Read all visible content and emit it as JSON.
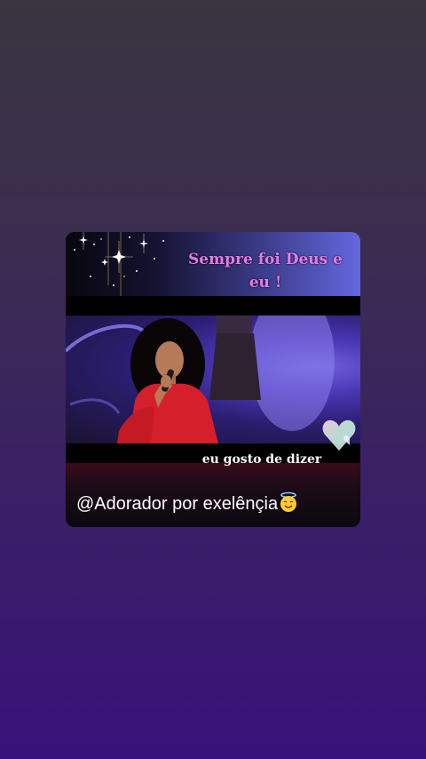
{
  "post": {
    "caption_top": "Sempre foi Deus e eu !",
    "caption_mid": "eu gosto de dizer",
    "handle": "@Adorador por exelênçia"
  },
  "icons": {
    "sparkles": "sparkles-icon",
    "heart": "heart-icon",
    "halo_emoji": "smiling-face-with-halo-icon"
  },
  "colors": {
    "caption_top": "#e47be6",
    "caption_mid": "#ffffff",
    "handle": "#ffffff"
  }
}
